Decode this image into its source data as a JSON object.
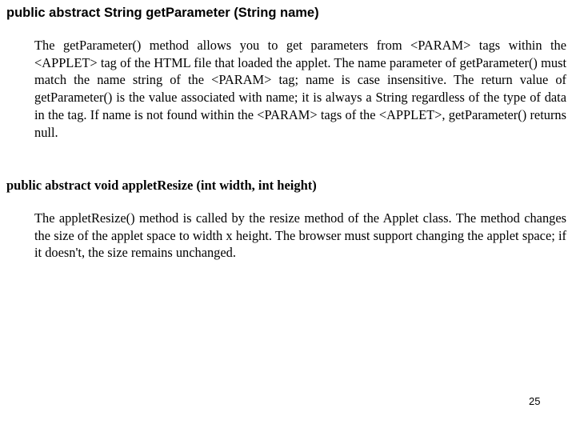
{
  "sections": [
    {
      "signature": "public abstract String getParameter (String name)",
      "description": "The getParameter() method allows you to get parameters from <PARAM> tags within the <APPLET> tag of the HTML file that loaded the applet. The name parameter of getParameter() must match the name string of the <PARAM> tag; name is case insensitive. The return value of getParameter() is the value associated with name; it is always a String regardless of the type of data in the tag. If name is not found within the <PARAM> tags of the <APPLET>, getParameter() returns null."
    },
    {
      "signature": "public abstract void appletResize (int width, int height)",
      "description": "The appletResize() method is called by the resize method of the Applet class. The method changes the size of the applet space to width x height. The browser must support changing the applet space; if it doesn't, the size remains unchanged."
    }
  ],
  "page_number": "25"
}
